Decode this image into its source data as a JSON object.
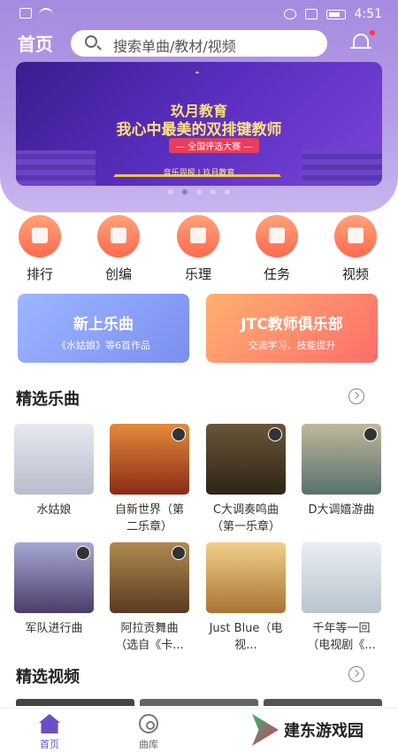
{
  "status_bar": {
    "time": "4:51"
  },
  "header": {
    "title": "首页",
    "search_placeholder": "搜索单曲/教材/视频"
  },
  "banner": {
    "brand": "玖月教育",
    "headline": "我心中最美的双排键教师",
    "tag": "— 全国评选大赛 —",
    "logos": "音乐周报 | 玖月教育",
    "page_count": 5,
    "active_index": 1
  },
  "categories": [
    {
      "label": "排行",
      "icon": "chart-icon"
    },
    {
      "label": "创编",
      "icon": "music-note-icon"
    },
    {
      "label": "乐理",
      "icon": "trophy-icon"
    },
    {
      "label": "任务",
      "icon": "flag-icon"
    },
    {
      "label": "视频",
      "icon": "video-icon"
    }
  ],
  "promos": [
    {
      "title": "新上乐曲",
      "subtitle": "《水姑娘》等6首作品"
    },
    {
      "title": "JTC教师俱乐部",
      "subtitle": "交流学习、技能提升"
    }
  ],
  "featured_music": {
    "title": "精选乐曲",
    "items": [
      {
        "title": "水姑娘",
        "color": "#cfd3df"
      },
      {
        "title": "自新世界（第二乐章）",
        "color": "#c1582a"
      },
      {
        "title": "C大调奏鸣曲（第一乐章）",
        "color": "#4a3a2a"
      },
      {
        "title": "D大调嬉游曲",
        "color": "#8a8e7a"
      },
      {
        "title": "军队进行曲",
        "color": "#6a6a9a"
      },
      {
        "title": "阿拉贡舞曲（选自《卡...",
        "color": "#7a5a3a"
      },
      {
        "title": "Just Blue（电视...",
        "color": "#d9b070"
      },
      {
        "title": "千年等一回（电视剧《...",
        "color": "#d6dfe6"
      }
    ]
  },
  "featured_video": {
    "title": "精选视频"
  },
  "tabbar": {
    "home": "首页",
    "library": "曲库"
  },
  "watermark": "建东游戏园"
}
